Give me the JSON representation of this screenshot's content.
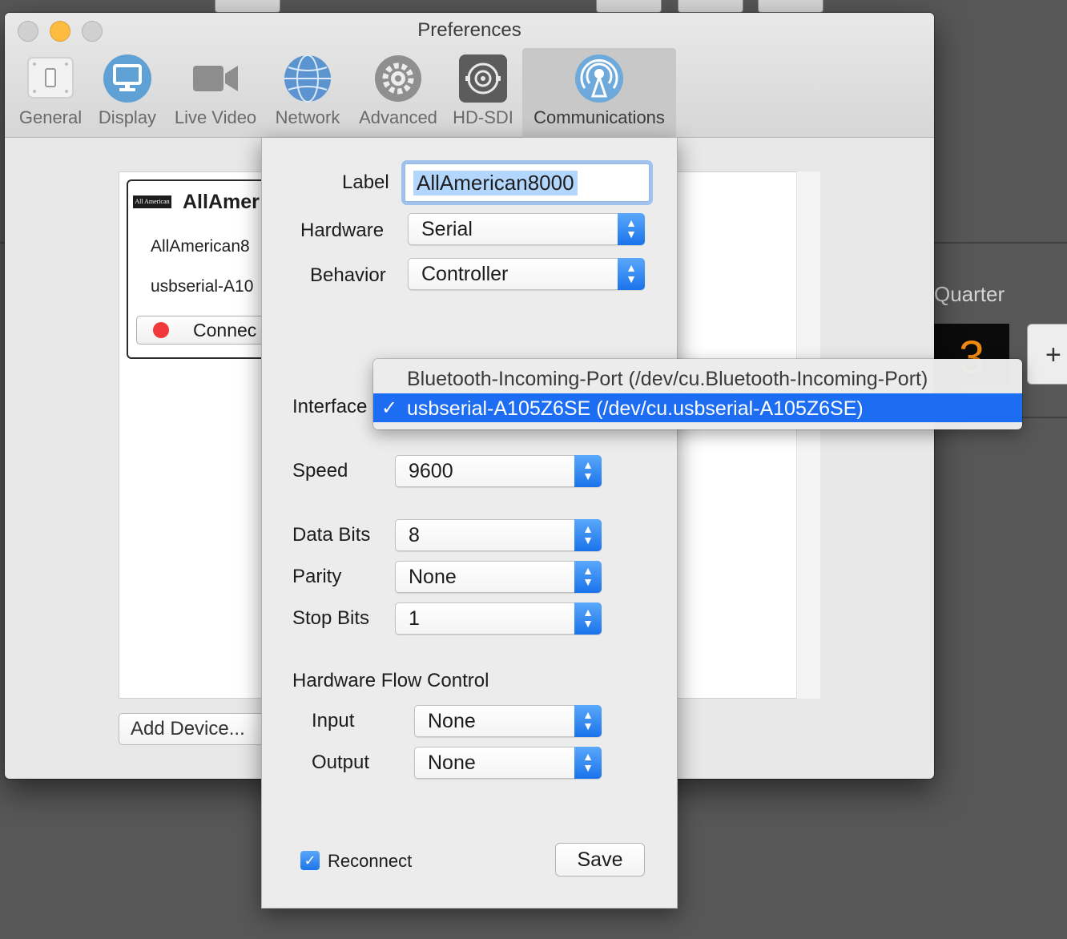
{
  "window": {
    "title": "Preferences"
  },
  "toolbar": {
    "items": [
      {
        "label": "General",
        "icon": "switch-icon"
      },
      {
        "label": "Display",
        "icon": "monitor-icon"
      },
      {
        "label": "Live Video",
        "icon": "video-camera-icon"
      },
      {
        "label": "Network",
        "icon": "globe-icon"
      },
      {
        "label": "Advanced",
        "icon": "gear-icon"
      },
      {
        "label": "HD-SDI",
        "icon": "sdi-connector-icon"
      },
      {
        "label": "Communications",
        "icon": "antenna-icon",
        "selected": true
      }
    ]
  },
  "background": {
    "quarter_label": "Quarter",
    "quarter_value": "3",
    "plus_label": "+"
  },
  "device_card": {
    "logo_text": "All American",
    "title": "AllAmer",
    "line1": "AllAmerican8",
    "line2": "usbserial-A10",
    "connect_label": "Connec"
  },
  "add_device_label": "Add Device...",
  "form": {
    "label": {
      "caption": "Label",
      "value": "AllAmerican8000"
    },
    "hardware": {
      "caption": "Hardware",
      "value": "Serial"
    },
    "behavior": {
      "caption": "Behavior",
      "value": "Controller"
    },
    "interface": {
      "caption": "Interface"
    },
    "speed": {
      "caption": "Speed",
      "value": "9600"
    },
    "data_bits": {
      "caption": "Data Bits",
      "value": "8"
    },
    "parity": {
      "caption": "Parity",
      "value": "None"
    },
    "stop_bits": {
      "caption": "Stop Bits",
      "value": "1"
    },
    "flow_control": {
      "heading": "Hardware Flow Control",
      "input": {
        "caption": "Input",
        "value": "None"
      },
      "output": {
        "caption": "Output",
        "value": "None"
      }
    },
    "reconnect": {
      "caption": "Reconnect",
      "checked": true
    },
    "save_label": "Save"
  },
  "interface_menu": {
    "options": [
      {
        "label": "Bluetooth-Incoming-Port (/dev/cu.Bluetooth-Incoming-Port)",
        "selected": false
      },
      {
        "label": "usbserial-A105Z6SE (/dev/cu.usbserial-A105Z6SE)",
        "selected": true
      }
    ],
    "check_glyph": "✓"
  },
  "colors": {
    "accent": "#1c6df2",
    "traffic_yellow": "#fdbc40",
    "status_red": "#f1383c",
    "quarter_digit": "#f08a12"
  }
}
